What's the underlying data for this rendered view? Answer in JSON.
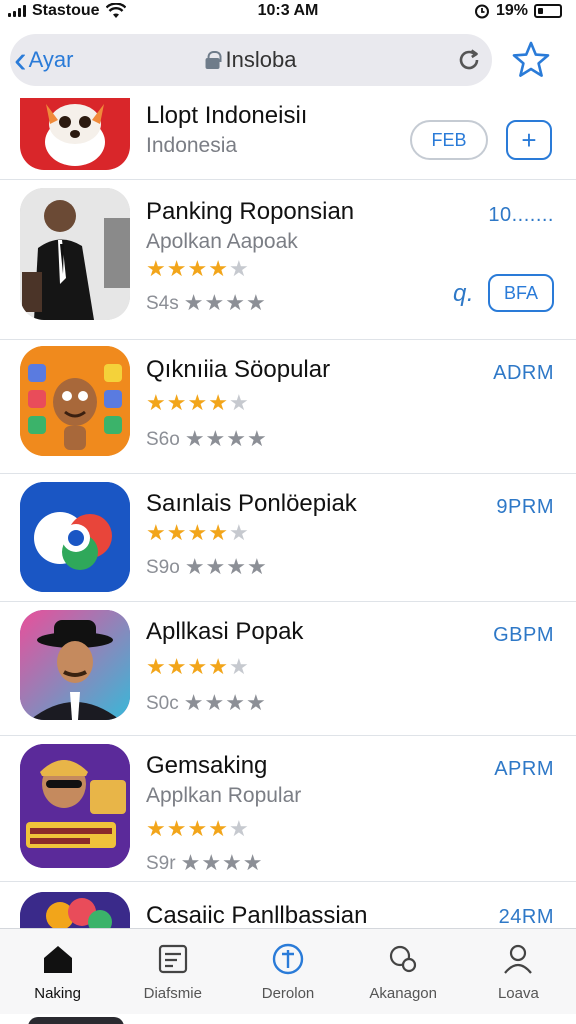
{
  "status_bar": {
    "carrier": "Stastoue",
    "time": "10:3 AM",
    "battery": "19%"
  },
  "nav": {
    "back_label": "Ayar",
    "url": "Insloba"
  },
  "apps": [
    {
      "name": "Llopt Indoneisiı",
      "subtitle": "Indonesia",
      "button_primary": "FEB",
      "button_secondary": "+",
      "dots": "•••••"
    },
    {
      "name": "Panking Roponsian",
      "subtitle": "Apolkan Aapoak",
      "rating_label": "S4s",
      "price": "10.......",
      "small_label": "q.",
      "button": "BFA"
    },
    {
      "name": "Qıknıiia Söopular",
      "rating_label": "S6o",
      "price": "ADRM"
    },
    {
      "name": "Saınlais Ponlöepiak",
      "rating_label": "S9o",
      "price": "9PRM"
    },
    {
      "name": "Apllkasi Popak",
      "rating_label": "S0c",
      "price": "GBPM"
    },
    {
      "name": "Gemsaking",
      "subtitle": "Applkan Ropular",
      "rating_label": "S9r",
      "price": "APRM"
    },
    {
      "name": "Casaiic Panllbassian",
      "price": "24RM"
    }
  ],
  "tabs": [
    {
      "label": "Naking"
    },
    {
      "label": "Diafsmie"
    },
    {
      "label": "Derolon"
    },
    {
      "label": "Akanagon"
    },
    {
      "label": "Loava"
    }
  ],
  "colors": {
    "accent": "#2a7bd8",
    "star_gold": "#f2a51a",
    "star_gray": "#8c8f96"
  }
}
